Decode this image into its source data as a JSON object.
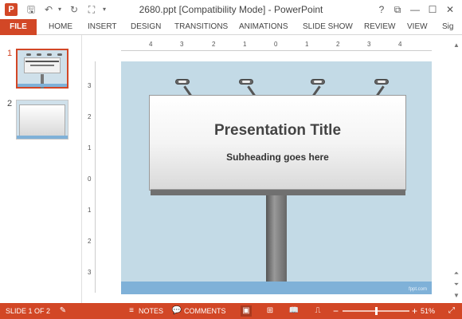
{
  "window": {
    "title": "2680.ppt [Compatibility Mode] - PowerPoint",
    "app_icon": "P",
    "controls": {
      "help": "?",
      "restore_ribbon": "⧉",
      "minimize": "—",
      "maximize": "☐",
      "close": "✕"
    }
  },
  "ribbon": {
    "tabs": [
      {
        "label": "FILE"
      },
      {
        "label": "HOME"
      },
      {
        "label": "INSERT"
      },
      {
        "label": "DESIGN"
      },
      {
        "label": "TRANSITIONS"
      },
      {
        "label": "ANIMATIONS"
      },
      {
        "label": "SLIDE SHOW"
      },
      {
        "label": "REVIEW"
      },
      {
        "label": "VIEW"
      },
      {
        "label": "Sig"
      }
    ]
  },
  "thumbnails": [
    {
      "number": "1",
      "active": true
    },
    {
      "number": "2",
      "active": false
    }
  ],
  "ruler": {
    "horizontal": [
      "4",
      "3",
      "2",
      "1",
      "0",
      "1",
      "2",
      "3",
      "4"
    ],
    "vertical": [
      "3",
      "2",
      "1",
      "0",
      "1",
      "2",
      "3"
    ]
  },
  "slide": {
    "title": "Presentation Title",
    "subtitle": "Subheading goes here",
    "watermark": "fppt.com"
  },
  "status": {
    "slide_indicator": "SLIDE 1 OF 2",
    "notes_label": "NOTES",
    "comments_label": "COMMENTS",
    "zoom_level": "51%",
    "zoom_minus": "−",
    "zoom_plus": "+",
    "zoom_fraction": 0.5
  },
  "colors": {
    "accent": "#d24726"
  }
}
